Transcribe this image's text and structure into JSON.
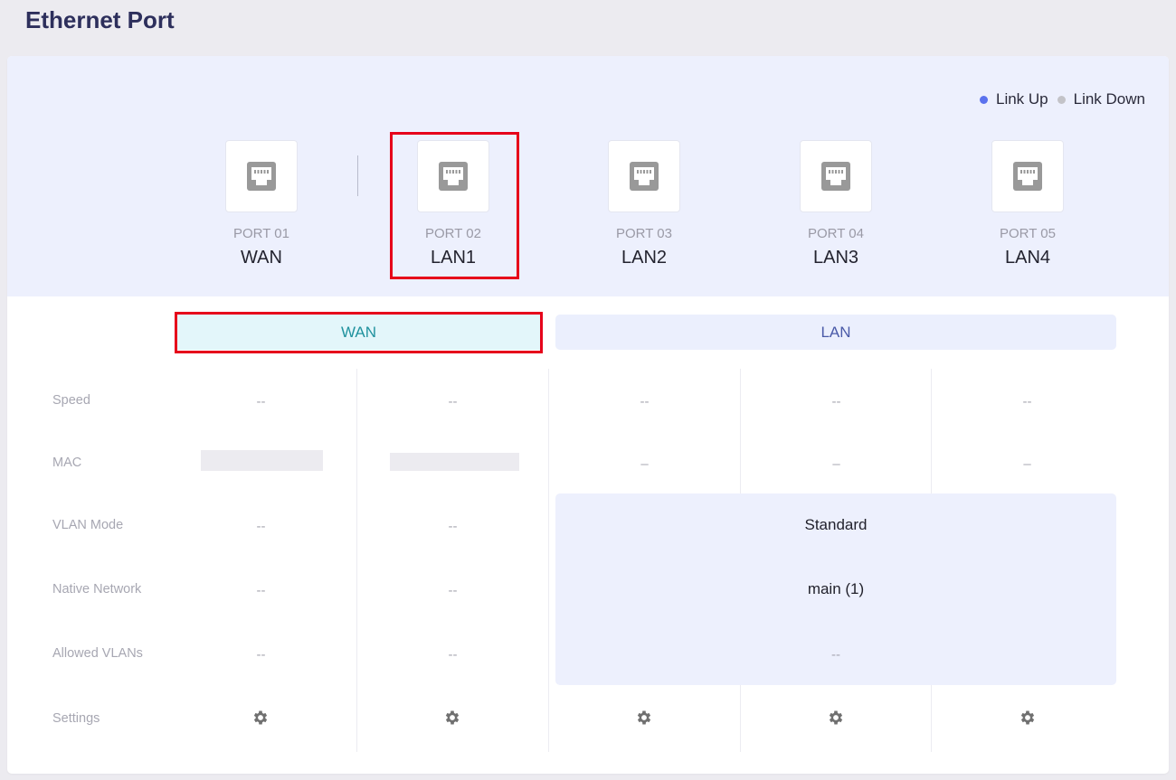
{
  "page": {
    "title": "Ethernet Port"
  },
  "legend": {
    "link_up": {
      "label": "Link Up",
      "color": "#5b72ee"
    },
    "link_down": {
      "label": "Link Down",
      "color": "#c3c3c8"
    }
  },
  "ports": [
    {
      "number": "PORT 01",
      "name": "WAN",
      "icon": "ethernet-port-icon"
    },
    {
      "number": "PORT 02",
      "name": "LAN1",
      "icon": "ethernet-port-icon"
    },
    {
      "number": "PORT 03",
      "name": "LAN2",
      "icon": "ethernet-port-icon"
    },
    {
      "number": "PORT 04",
      "name": "LAN3",
      "icon": "ethernet-port-icon"
    },
    {
      "number": "PORT 05",
      "name": "LAN4",
      "icon": "ethernet-port-icon"
    }
  ],
  "tabs": {
    "wan": "WAN",
    "lan": "LAN"
  },
  "rows": {
    "speed": "Speed",
    "mac": "MAC",
    "vlan_mode": "VLAN Mode",
    "native_network": "Native Network",
    "allowed_vlans": "Allowed VLANs",
    "settings": "Settings"
  },
  "values": {
    "empty": "--",
    "empty_short": "–",
    "lan_vlan_mode": "Standard",
    "lan_native_network": "main (1)",
    "lan_allowed_vlans": "--"
  },
  "colors": {
    "accent_red": "#e6001a",
    "wan_tab_text": "#20929e",
    "lan_tab_text": "#4a5aa8",
    "title": "#2d2f5c"
  }
}
